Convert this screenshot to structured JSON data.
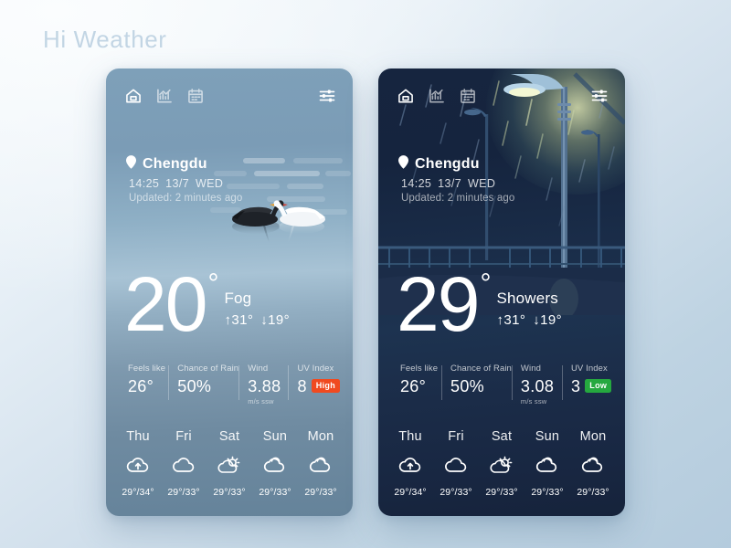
{
  "app": {
    "title": "Hi Weather"
  },
  "colors": {
    "uv_high_badge": "#f04a20",
    "uv_low_badge": "#25a83f",
    "day_card_base": "#7c9eb8",
    "night_card_base": "#1a2c48",
    "page_bg_top": "#f3f8fb",
    "page_bg_bottom": "#b4cbdd"
  },
  "nav": {
    "home_label": "Home",
    "stats_label": "Statistics",
    "calendar_label": "Calendar",
    "settings_label": "Settings",
    "icons": [
      "home-icon",
      "chart-icon",
      "calendar-icon",
      "sliders-icon"
    ]
  },
  "cards": [
    {
      "id": "day",
      "scene": "swans-on-misty-lake",
      "location": {
        "pin_icon": "location-pin-icon",
        "city": "Chengdu",
        "time": "14:25",
        "date": "13/7",
        "weekday": "WED",
        "datetime_line": "14:25  13/7  WED",
        "updated": "Updated: 2 minutes ago"
      },
      "current": {
        "temperature": "20",
        "degree": "°",
        "condition": "Fog",
        "high": "↑31°",
        "low": "↓19°"
      },
      "stats": [
        {
          "label": "Feels like",
          "value": "26°",
          "unit": "",
          "badge": null
        },
        {
          "label": "Chance of Rain",
          "value": "50%",
          "unit": "",
          "badge": null
        },
        {
          "label": "Wind",
          "value": "3.88",
          "unit": "m/s ssw",
          "badge": null
        },
        {
          "label": "UV Index",
          "value": "8",
          "unit": "",
          "badge": {
            "text": "High",
            "color": "#f04a20"
          }
        }
      ],
      "forecast": [
        {
          "day": "Thu",
          "icon": "cloud-arrow-icon",
          "temps": "29°/34°"
        },
        {
          "day": "Fri",
          "icon": "cloud-icon",
          "temps": "29°/33°"
        },
        {
          "day": "Sat",
          "icon": "sun-behind-cloud-icon",
          "temps": "29°/33°"
        },
        {
          "day": "Sun",
          "icon": "partly-cloudy-icon",
          "temps": "29°/33°"
        },
        {
          "day": "Mon",
          "icon": "partly-cloudy-icon",
          "temps": "29°/33°"
        }
      ]
    },
    {
      "id": "night",
      "scene": "rainy-night-street-lamps",
      "location": {
        "pin_icon": "location-pin-icon",
        "city": "Chengdu",
        "time": "14:25",
        "date": "13/7",
        "weekday": "WED",
        "datetime_line": "14:25  13/7  WED",
        "updated": "Updated: 2 minutes ago"
      },
      "current": {
        "temperature": "29",
        "degree": "°",
        "condition": "Showers",
        "high": "↑31°",
        "low": "↓19°"
      },
      "stats": [
        {
          "label": "Feels like",
          "value": "26°",
          "unit": "",
          "badge": null
        },
        {
          "label": "Chance of Rain",
          "value": "50%",
          "unit": "",
          "badge": null
        },
        {
          "label": "Wind",
          "value": "3.08",
          "unit": "m/s ssw",
          "badge": null
        },
        {
          "label": "UV Index",
          "value": "3",
          "unit": "",
          "badge": {
            "text": "Low",
            "color": "#25a83f"
          }
        }
      ],
      "forecast": [
        {
          "day": "Thu",
          "icon": "cloud-arrow-icon",
          "temps": "29°/34°"
        },
        {
          "day": "Fri",
          "icon": "cloud-icon",
          "temps": "29°/33°"
        },
        {
          "day": "Sat",
          "icon": "sun-behind-cloud-icon",
          "temps": "29°/33°"
        },
        {
          "day": "Sun",
          "icon": "partly-cloudy-icon",
          "temps": "29°/33°"
        },
        {
          "day": "Mon",
          "icon": "partly-cloudy-icon",
          "temps": "29°/33°"
        }
      ]
    }
  ]
}
